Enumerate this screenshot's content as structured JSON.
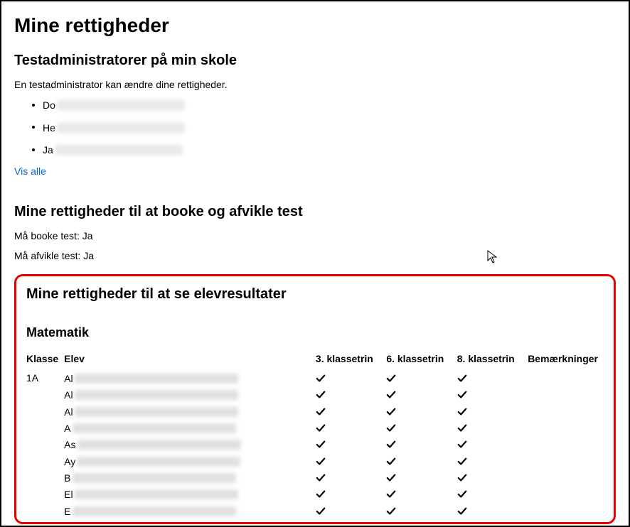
{
  "page": {
    "title": "Mine rettigheder"
  },
  "admins": {
    "heading": "Testadministratorer på min skole",
    "intro": "En testadministrator kan ændre dine rettigheder.",
    "items": [
      {
        "prefix": "Do"
      },
      {
        "prefix": "He"
      },
      {
        "prefix": "Ja"
      }
    ],
    "show_all": "Vis alle"
  },
  "booking": {
    "heading": "Mine rettigheder til at booke og afvikle test",
    "can_book": "Må booke test: Ja",
    "can_run": "Må afvikle test: Ja"
  },
  "results": {
    "heading": "Mine rettigheder til at se elevresultater",
    "subject": "Matematik",
    "columns": {
      "klasse": "Klasse",
      "elev": "Elev",
      "g3": "3. klassetrin",
      "g6": "6. klassetrin",
      "g8": "8. klassetrin",
      "remarks": "Bemærkninger"
    },
    "rows": [
      {
        "klasse": "1A",
        "prefix": "Al",
        "g3": true,
        "g6": true,
        "g8": true
      },
      {
        "klasse": "",
        "prefix": "Al",
        "g3": true,
        "g6": true,
        "g8": true
      },
      {
        "klasse": "",
        "prefix": "Al",
        "g3": true,
        "g6": true,
        "g8": true
      },
      {
        "klasse": "",
        "prefix": "A",
        "g3": true,
        "g6": true,
        "g8": true
      },
      {
        "klasse": "",
        "prefix": "As",
        "g3": true,
        "g6": true,
        "g8": true
      },
      {
        "klasse": "",
        "prefix": "Ay",
        "g3": true,
        "g6": true,
        "g8": true
      },
      {
        "klasse": "",
        "prefix": "B",
        "g3": true,
        "g6": true,
        "g8": true
      },
      {
        "klasse": "",
        "prefix": "El",
        "g3": true,
        "g6": true,
        "g8": true
      },
      {
        "klasse": "",
        "prefix": "E",
        "g3": true,
        "g6": true,
        "g8": true
      }
    ]
  }
}
